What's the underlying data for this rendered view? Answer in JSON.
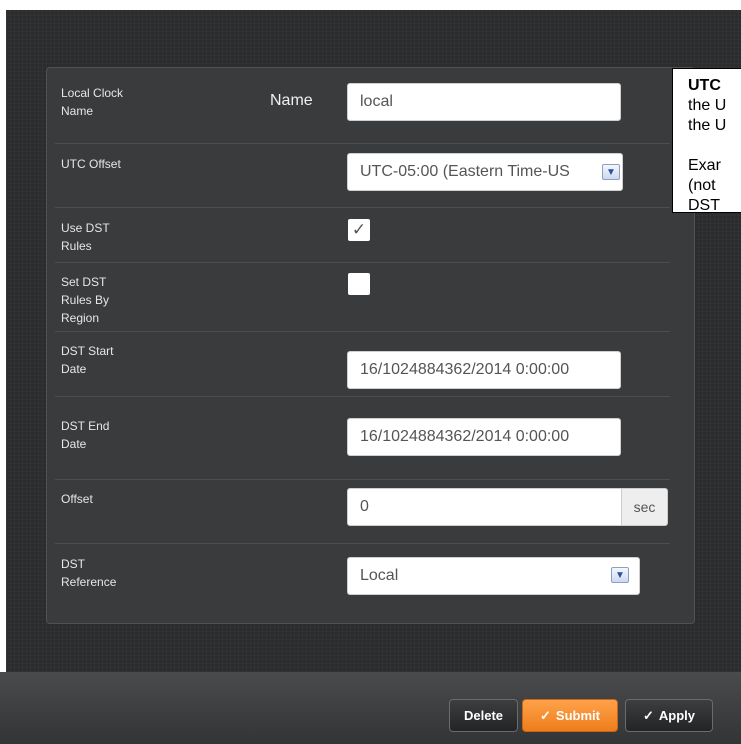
{
  "form": {
    "local_clock_name_label": "Local Clock\nName",
    "name_label": "Name",
    "name_value": "local",
    "utc_offset_label": "UTC Offset",
    "utc_offset_value": "UTC-05:00 (Eastern Time-US",
    "use_dst_label": "Use DST\nRules",
    "use_dst_checked": true,
    "set_dst_region_label": "Set DST\nRules By\nRegion",
    "set_dst_region_checked": false,
    "dst_start_label": "DST Start\nDate",
    "dst_start_value": "16/1024884362/2014 0:00:00",
    "dst_end_label": "DST End\nDate",
    "dst_end_value": "16/1024884362/2014 0:00:00",
    "offset_label": "Offset",
    "offset_value": "0",
    "offset_unit": "sec",
    "dst_ref_label": "DST\nReference",
    "dst_ref_value": "Local"
  },
  "tooltip": {
    "title": "UTC",
    "line1": "the U",
    "line2": "the U",
    "line3": "Exar",
    "line4": "(not",
    "line5": "DST"
  },
  "footer": {
    "delete_label": "Delete",
    "submit_label": "Submit",
    "apply_label": "Apply"
  },
  "icons": {
    "check": "✓",
    "chevron": "▼"
  },
  "colors": {
    "panel_bg": "#2b2c2d",
    "form_bg": "#3a3b3c",
    "submit_orange": "#f28a2a"
  }
}
